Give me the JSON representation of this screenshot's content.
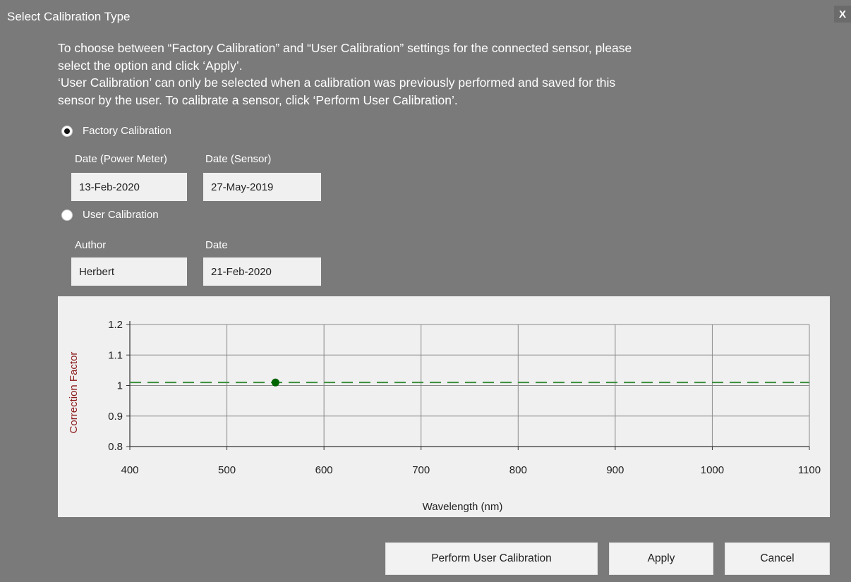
{
  "window": {
    "title": "Select Calibration Type",
    "close_label": "X"
  },
  "intro": {
    "line1": "To choose between “Factory Calibration” and “User Calibration” settings for the connected sensor, please",
    "line2": "select the option and click ‘Apply’.",
    "line3": "‘User Calibration’ can only be selected when a calibration was previously performed and saved for this",
    "line4": "sensor by the user.  To calibrate a sensor, click ‘Perform User Calibration’."
  },
  "factory": {
    "label": "Factory Calibration",
    "selected": true,
    "date_power_meter_label": "Date (Power Meter)",
    "date_power_meter_value": "13-Feb-2020",
    "date_sensor_label": "Date (Sensor)",
    "date_sensor_value": "27-May-2019"
  },
  "user": {
    "label": "User Calibration",
    "selected": false,
    "author_label": "Author",
    "author_value": "Herbert",
    "date_label": "Date",
    "date_value": "21-Feb-2020"
  },
  "chart_data": {
    "type": "scatter",
    "xlabel": "Wavelength (nm)",
    "ylabel": "Correction Factor",
    "xlim": [
      400,
      1100
    ],
    "ylim": [
      0.8,
      1.2
    ],
    "xticks": [
      "400",
      "500",
      "600",
      "700",
      "800",
      "900",
      "1000",
      "1100"
    ],
    "yticks": [
      "1.2",
      "1.1",
      "1",
      "0.9",
      "0.8"
    ],
    "grid": true,
    "points": [
      {
        "x": 550,
        "y": 1.01
      }
    ],
    "reference_line": {
      "y": 1.01,
      "style": "dashed"
    },
    "colors": {
      "point": "#006400",
      "line": "#3a8f3a",
      "grid": "#8a8a8a",
      "ylabel": "#8b1a1a"
    }
  },
  "buttons": {
    "perform": "Perform User Calibration",
    "apply": "Apply",
    "cancel": "Cancel"
  }
}
